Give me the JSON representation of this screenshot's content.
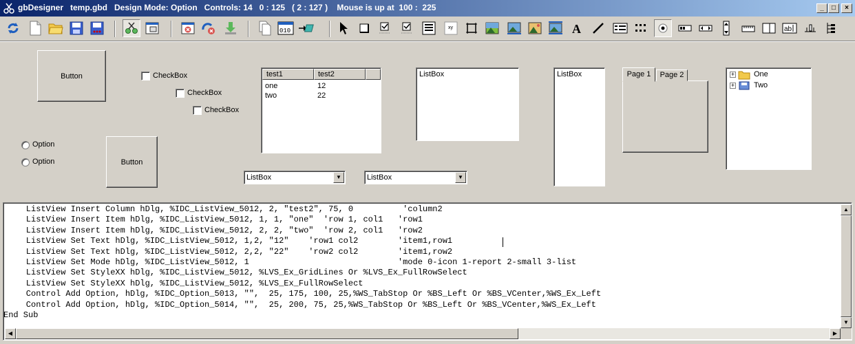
{
  "window": {
    "title": "gbDesigner   temp.gbd   Design Mode: Option   Controls: 14   0 : 125   ( 2 : 127 )    Mouse is up at  100 :  225"
  },
  "controls": {
    "button1": "Button",
    "button2": "Button",
    "checkbox1": "CheckBox",
    "checkbox2": "CheckBox",
    "checkbox3": "CheckBox",
    "option1": "Option",
    "option2": "Option",
    "listview": {
      "columns": [
        "test1",
        "test2"
      ],
      "rows": [
        [
          "one",
          "12"
        ],
        [
          "two",
          "22"
        ]
      ]
    },
    "listbox1": "ListBox",
    "listbox2": "ListBox",
    "combo1": "ListBox",
    "combo2": "ListBox",
    "tabs": [
      "Page 1",
      "Page 2"
    ],
    "tree": [
      "One",
      "Two"
    ]
  },
  "code": [
    "    ListView Insert Column hDlg, %IDC_ListView_5012, 2, \"test2\", 75, 0          'column2",
    "    ListView Insert Item hDlg, %IDC_ListView_5012, 1, 1, \"one\"  'row 1, col1   'row1",
    "    ListView Insert Item hDlg, %IDC_ListView_5012, 2, 2, \"two\"  'row 2, col1   'row2",
    "    ListView Set Text hDlg, %IDC_ListView_5012, 1,2, \"12\"    'row1 col2        'item1,row1",
    "    ListView Set Text hDlg, %IDC_ListView_5012, 2,2, \"22\"    'row2 col2        'item1,row2",
    "    ListView Set Mode hDlg, %IDC_ListView_5012, 1                              'mode 0-icon 1-report 2-small 3-list",
    "    ListView Set StyleXX hDlg, %IDC_ListView_5012, %LVS_Ex_GridLines Or %LVS_Ex_FullRowSelect",
    "    ListView Set StyleXX hDlg, %IDC_ListView_5012, %LVS_Ex_FullRowSelect",
    "    Control Add Option, hDlg, %IDC_Option_5013, \"\",  25, 175, 100, 25,%WS_TabStop Or %BS_Left Or %BS_VCenter,%WS_Ex_Left",
    "    Control Add Option, hDlg, %IDC_Option_5014, \"\",  25, 200, 75, 25,%WS_TabStop Or %BS_Left Or %BS_VCenter,%WS_Ex_Left",
    "End Sub"
  ]
}
